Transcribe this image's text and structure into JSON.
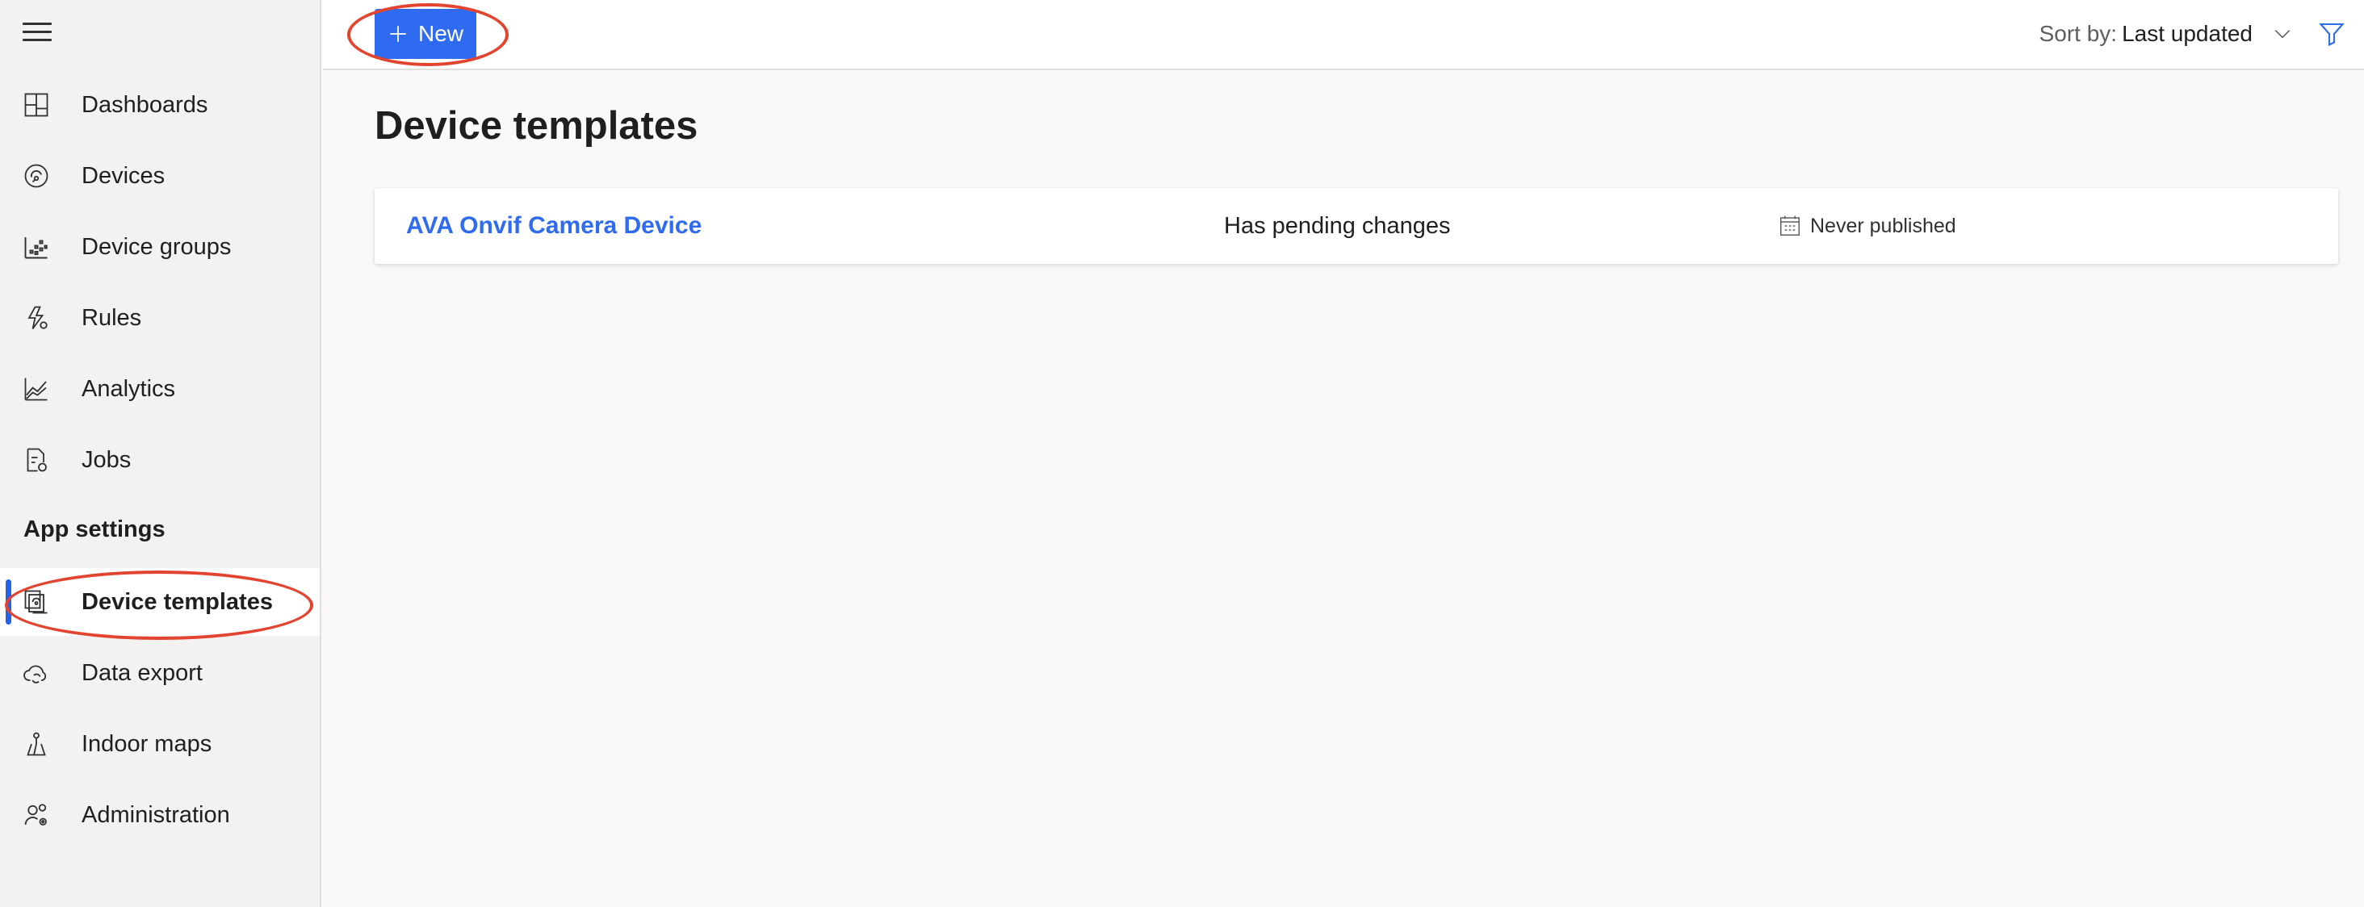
{
  "sidebar": {
    "items": [
      {
        "label": "Dashboards",
        "icon": "dashboard-icon"
      },
      {
        "label": "Devices",
        "icon": "devices-icon"
      },
      {
        "label": "Device groups",
        "icon": "device-groups-icon"
      },
      {
        "label": "Rules",
        "icon": "rules-icon"
      },
      {
        "label": "Analytics",
        "icon": "analytics-icon"
      },
      {
        "label": "Jobs",
        "icon": "jobs-icon"
      }
    ],
    "section_heading": "App settings",
    "settings_items": [
      {
        "label": "Device templates",
        "icon": "device-templates-icon",
        "selected": true
      },
      {
        "label": "Data export",
        "icon": "data-export-icon"
      },
      {
        "label": "Indoor maps",
        "icon": "indoor-maps-icon"
      },
      {
        "label": "Administration",
        "icon": "administration-icon"
      }
    ]
  },
  "toolbar": {
    "new_label": "New",
    "sort_prefix": "Sort by:",
    "sort_value": "Last updated"
  },
  "main": {
    "title": "Device templates",
    "templates": [
      {
        "name": "AVA Onvif Camera Device",
        "status": "Has pending changes",
        "published": "Never published"
      }
    ]
  },
  "colors": {
    "accent": "#2f6bf0",
    "selection_bar": "#2563eb",
    "annotation": "#e2442f",
    "sidebar_bg": "#f3f2f1",
    "content_bg": "#faf9f8"
  }
}
